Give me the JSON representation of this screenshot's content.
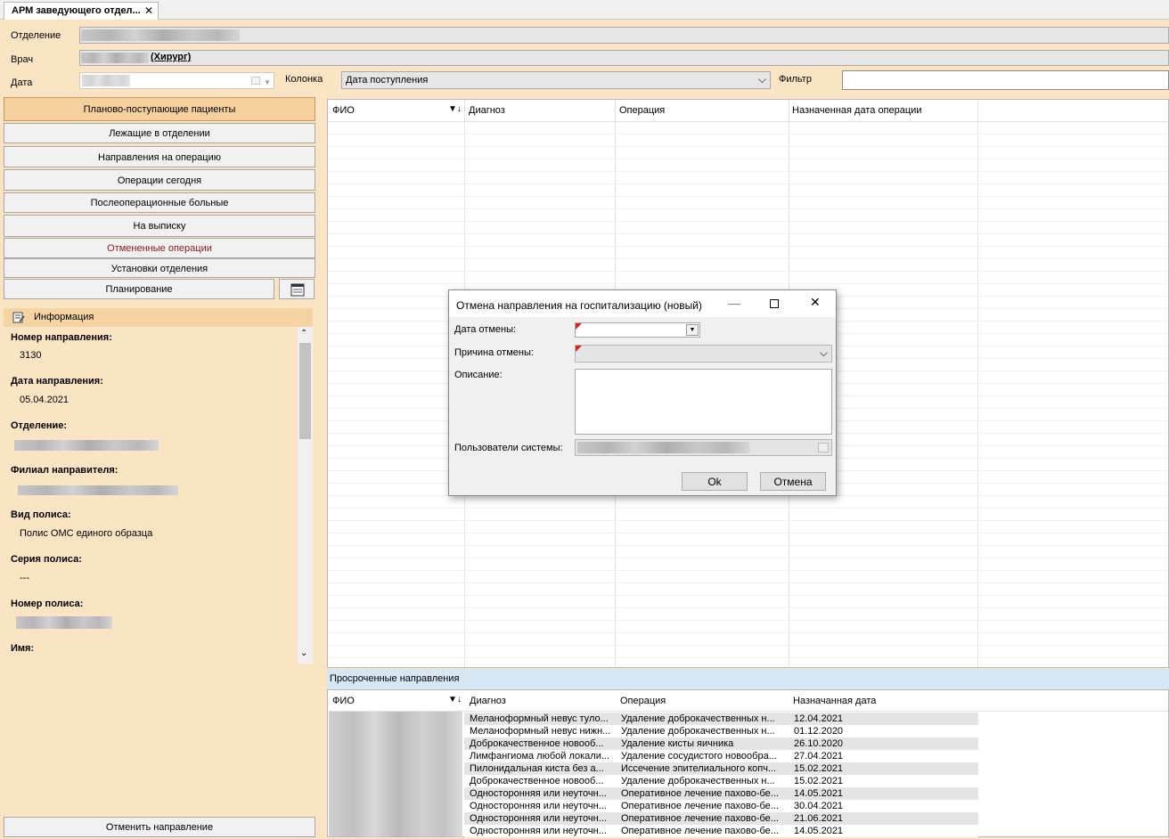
{
  "tab": {
    "title": "АРМ заведующего отдел...",
    "close": "✕"
  },
  "header": {
    "department_label": "Отделение",
    "doctor_label": "Врач",
    "doctor_suffix": "(Хирург)",
    "date_label": "Дата",
    "column_label": "Колонка",
    "column_value": "Дата поступления",
    "filter_label": "Фильтр"
  },
  "nav": {
    "items": [
      "Планово-поступающие пациенты",
      "Лежащие в отделении",
      "Направления на операцию",
      "Операции сегодня",
      "Послеоперационные больные",
      "На выписку",
      "Отмененные операции",
      "Установки отделения",
      "Планирование"
    ]
  },
  "info": {
    "title": "Информация",
    "fields": [
      {
        "label": "Номер направления:",
        "value": "3130"
      },
      {
        "label": "Дата направления:",
        "value": "05.04.2021"
      },
      {
        "label": "Отделение:",
        "value": ""
      },
      {
        "label": "Филиал направителя:",
        "value": ""
      },
      {
        "label": "Вид полиса:",
        "value": "Полис ОМС единого образца"
      },
      {
        "label": "Серия полиса:",
        "value": "---"
      },
      {
        "label": "Номер полиса:",
        "value": ""
      },
      {
        "label": "Имя:",
        "value": ""
      }
    ]
  },
  "main_grid": {
    "columns": [
      "ФИО",
      "Диагноз",
      "Операция",
      "Назначенная дата операции"
    ]
  },
  "overdue": {
    "title": "Просроченные направления",
    "columns": [
      "ФИО",
      "Диагноз",
      "Операция",
      "Назначанная дата"
    ],
    "rows": [
      {
        "diagnosis": "Меланоформный невус туло...",
        "operation": "Удаление доброкачественных н...",
        "date": "12.04.2021"
      },
      {
        "diagnosis": "Меланоформный невус нижн...",
        "operation": "Удаление доброкачественных н...",
        "date": "01.12.2020"
      },
      {
        "diagnosis": "Доброкачественное новооб...",
        "operation": "Удаление кисты яичника",
        "date": "26.10.2020"
      },
      {
        "diagnosis": "Лимфангиома любой локали...",
        "operation": "Удаление сосудистого новообра...",
        "date": "27.04.2021"
      },
      {
        "diagnosis": "Пилонидальная киста без а...",
        "operation": "Иссечение эпителиального копч...",
        "date": "15.02.2021"
      },
      {
        "diagnosis": "Доброкачественное новооб...",
        "operation": "Удаление доброкачественных н...",
        "date": "15.02.2021"
      },
      {
        "diagnosis": "Односторонняя или неуточн...",
        "operation": "Оперативное лечение пахово-бе...",
        "date": "14.05.2021"
      },
      {
        "diagnosis": "Односторонняя или неуточн...",
        "operation": "Оперативное лечение пахово-бе...",
        "date": "30.04.2021"
      },
      {
        "diagnosis": "Односторонняя или неуточн...",
        "operation": "Оперативное лечение пахово-бе...",
        "date": "21.06.2021"
      },
      {
        "diagnosis": "Односторонняя или неуточн...",
        "operation": "Оперативное лечение пахово-бе...",
        "date": "14.05.2021"
      }
    ]
  },
  "cancel_referral_button": "Отменить направление",
  "dialog": {
    "title": "Отмена направления на госпитализацию (новый)",
    "cancel_date_label": "Дата отмены:",
    "reason_label": "Причина отмены:",
    "description_label": "Описание:",
    "users_label": "Пользователи системы:",
    "ok": "Ok",
    "cancel": "Отмена"
  }
}
